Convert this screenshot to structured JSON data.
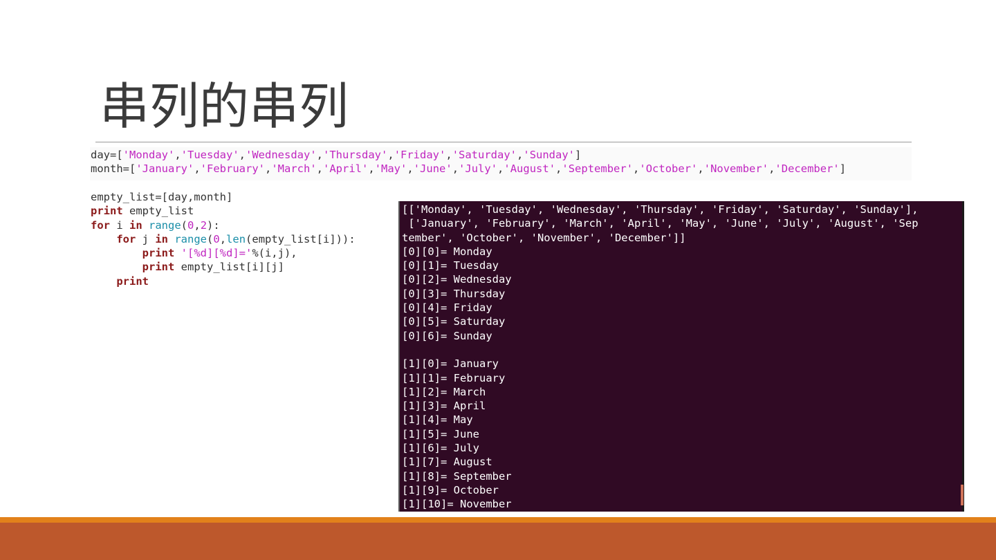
{
  "slide": {
    "title": "串列的串列"
  },
  "code": {
    "line_day": {
      "prefix": "day=[",
      "items": [
        "'Monday'",
        "'Tuesday'",
        "'Wednesday'",
        "'Thursday'",
        "'Friday'",
        "'Saturday'",
        "'Sunday'"
      ],
      "suffix": "]"
    },
    "line_month": {
      "prefix": "month=[",
      "items": [
        "'January'",
        "'February'",
        "'March'",
        "'April'",
        "'May'",
        "'June'",
        "'July'",
        "'August'",
        "'September'",
        "'October'",
        "'November'",
        "'December'"
      ],
      "suffix": "]"
    },
    "line_empty": "empty_list=[day,month]",
    "line_print_kw": "print",
    "line_print_rest": " empty_list",
    "line_for1_kw1": "for",
    "line_for1_mid": " i ",
    "line_for1_kw2": "in",
    "line_for1_bi": " range",
    "line_for1_open": "(",
    "line_for1_n1": "0",
    "line_for1_comma": ",",
    "line_for1_n2": "2",
    "line_for1_close": "):",
    "line_for2_indent": "    ",
    "line_for2_kw1": "for",
    "line_for2_mid": " j ",
    "line_for2_kw2": "in",
    "line_for2_bi": " range",
    "line_for2_open": "(",
    "line_for2_n1": "0",
    "line_for2_comma": ",",
    "line_for2_bi2": "len",
    "line_for2_rest": "(empty_list[i])):",
    "line_p1_indent": "        ",
    "line_p1_kw": "print",
    "line_p1_str": " '[%d][%d]='",
    "line_p1_rest": "%(i,j),",
    "line_p2_indent": "        ",
    "line_p2_kw": "print",
    "line_p2_rest": " empty_list[i][j]",
    "line_p3_indent": "    ",
    "line_p3_kw": "print"
  },
  "terminal": {
    "lines": [
      "[['Monday', 'Tuesday', 'Wednesday', 'Thursday', 'Friday', 'Saturday', 'Sunday'],",
      " ['January', 'February', 'March', 'April', 'May', 'June', 'July', 'August', 'Sep",
      "tember', 'October', 'November', 'December']]",
      "[0][0]= Monday",
      "[0][1]= Tuesday",
      "[0][2]= Wednesday",
      "[0][3]= Thursday",
      "[0][4]= Friday",
      "[0][5]= Saturday",
      "[0][6]= Sunday",
      "",
      "[1][0]= January",
      "[1][1]= February",
      "[1][2]= March",
      "[1][3]= April",
      "[1][4]= May",
      "[1][5]= June",
      "[1][6]= July",
      "[1][7]= August",
      "[1][8]= September",
      "[1][9]= October",
      "[1][10]= November"
    ]
  },
  "colors": {
    "footer_stripe": "#e2811b",
    "footer_bar": "#bd582c",
    "terminal_bg": "#300a24",
    "keyword": "#8b1a1a",
    "string": "#c026c0",
    "builtin": "#1a8ea8"
  }
}
